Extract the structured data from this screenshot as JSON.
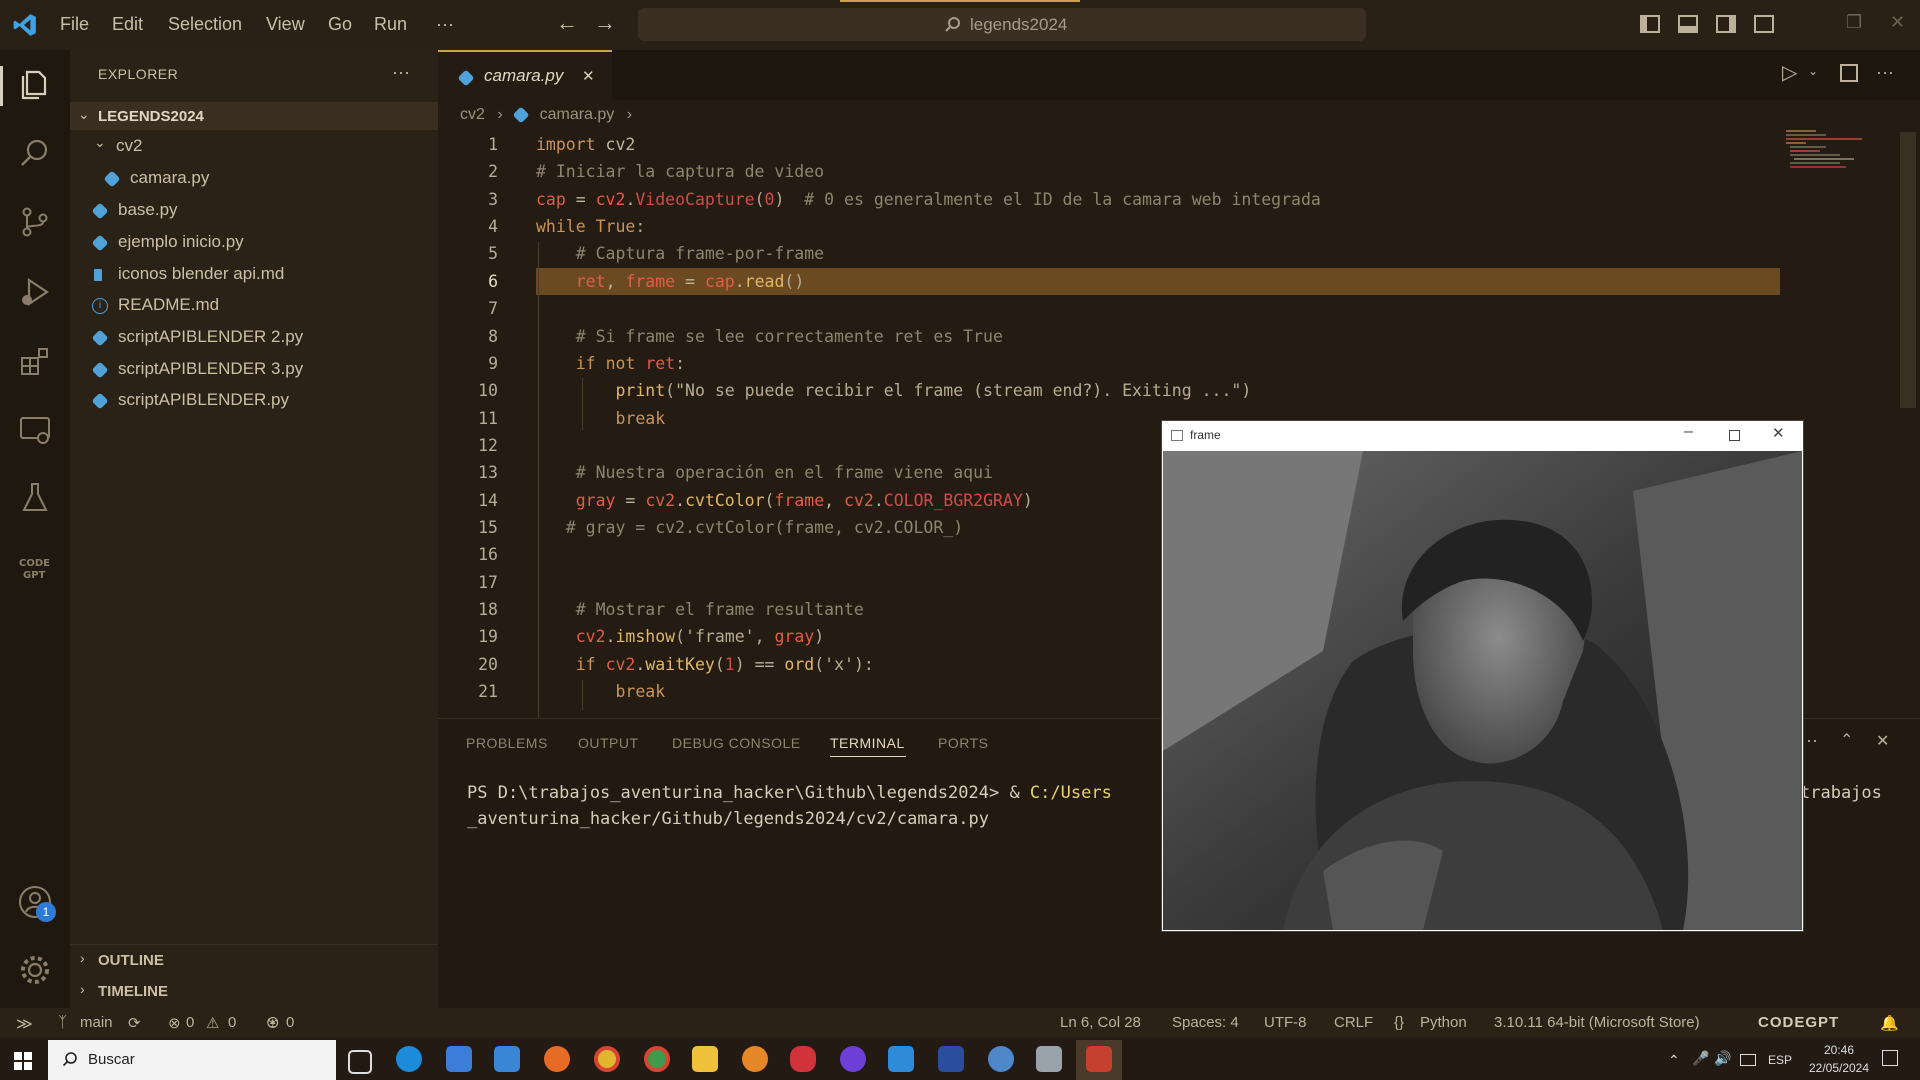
{
  "menu": [
    "File",
    "Edit",
    "Selection",
    "View",
    "Go",
    "Run",
    "···"
  ],
  "command_center": {
    "text": "legends2024"
  },
  "explorer": {
    "title": "EXPLORER",
    "more": "···",
    "root": "LEGENDS2024",
    "folder": "cv2",
    "files": [
      {
        "name": "camara.py",
        "icon": "python-icon"
      },
      {
        "name": "base.py",
        "icon": "python-icon"
      },
      {
        "name": "ejemplo inicio.py",
        "icon": "python-icon"
      },
      {
        "name": "iconos blender api.md",
        "icon": "markdown-icon"
      },
      {
        "name": "README.md",
        "icon": "info-icon"
      },
      {
        "name": "scriptAPIBLENDER 2.py",
        "icon": "python-icon"
      },
      {
        "name": "scriptAPIBLENDER 3.py",
        "icon": "python-icon"
      },
      {
        "name": "scriptAPIBLENDER.py",
        "icon": "python-icon"
      }
    ],
    "outline": "OUTLINE",
    "timeline": "TIMELINE"
  },
  "tab": {
    "name": "camara.py",
    "close": "✕"
  },
  "breadcrumb": {
    "folder": "cv2",
    "file": "camara.py"
  },
  "code": {
    "line_numbers": [
      "1",
      "2",
      "3",
      "4",
      "5",
      "6",
      "7",
      "8",
      "9",
      "10",
      "11",
      "12",
      "13",
      "14",
      "15",
      "16",
      "17",
      "18",
      "19",
      "20",
      "21"
    ],
    "highlighted_line": 6
  },
  "panel": {
    "tabs": [
      "PROBLEMS",
      "OUTPUT",
      "DEBUG CONSOLE",
      "TERMINAL",
      "PORTS"
    ],
    "active_tab": "TERMINAL",
    "terminal_line1_prompt": "PS D:\\trabajos_aventurina_hacker\\Github\\legends2024> & ",
    "terminal_line1_cmd": "C:/Users",
    "terminal_line1_tail": "trabajos",
    "terminal_line2": "_aventurina_hacker/Github/legends2024/cv2/camara.py"
  },
  "frame_window": {
    "title": "frame"
  },
  "status": {
    "branch": "main",
    "errors": "0",
    "warnings": "0",
    "ports": "0",
    "position": "Ln 6, Col 28",
    "spaces": "Spaces: 4",
    "encoding": "UTF-8",
    "eol": "CRLF",
    "language": "Python",
    "interpreter": "3.10.11 64-bit (Microsoft Store)",
    "codegpt": "CODEGPT"
  },
  "accounts_badge": "1",
  "taskbar": {
    "search_placeholder": "Buscar",
    "lang": "ESP",
    "time": "20:46",
    "date": "22/05/2024"
  },
  "colors": {
    "accent": "#c8a050",
    "highlight_line": "#6b4a22",
    "status_bg": "#2b2116"
  }
}
